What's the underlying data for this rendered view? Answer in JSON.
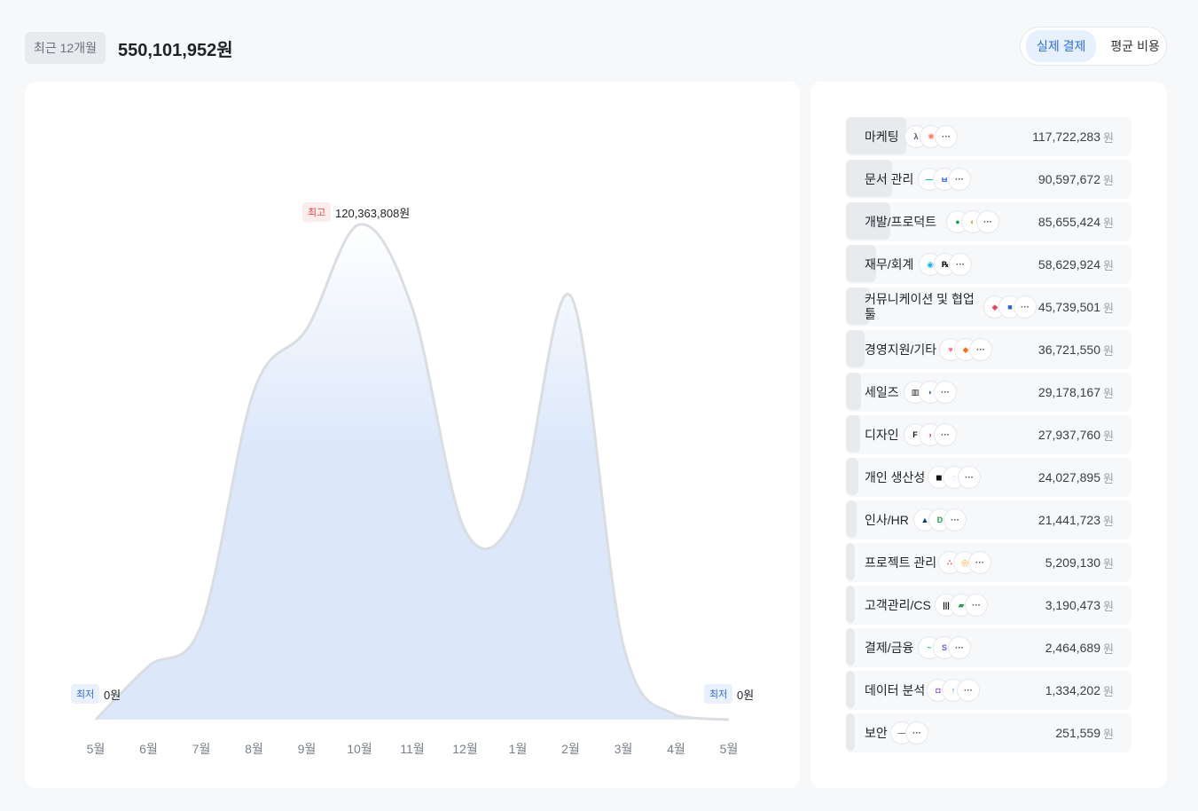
{
  "header": {
    "period": "최근 12개월",
    "total": "550,101,952원"
  },
  "toggle": {
    "actual": "실제 결제",
    "average": "평균 비용",
    "active": "actual"
  },
  "chart": {
    "max_tag": "최고",
    "max_value": "120,363,808원",
    "min_tag": "최저",
    "min_value_left": "0원",
    "min_value_right": "0원"
  },
  "chart_data": {
    "type": "area",
    "categories": [
      "5월",
      "6월",
      "7월",
      "8월",
      "9월",
      "10월",
      "11월",
      "12월",
      "1월",
      "2월",
      "3월",
      "4월",
      "5월"
    ],
    "values": [
      0,
      13000000,
      23000000,
      80000000,
      95000000,
      120363808,
      100000000,
      46000000,
      51000000,
      103000000,
      18000000,
      1000000,
      0
    ],
    "ylim": [
      0,
      120363808
    ],
    "color": "#dce8fa",
    "stroke": "#dadde2"
  },
  "categories": [
    {
      "name": "마케팅",
      "amount": "117,722,283",
      "unit": "원",
      "share": 1.0,
      "icons": [
        {
          "g": "λ",
          "c": "#4b5563"
        },
        {
          "g": "✺",
          "c": "#ff7a59"
        },
        {
          "g": "···",
          "c": "#555"
        }
      ]
    },
    {
      "name": "문서 관리",
      "amount": "90,597,672",
      "unit": "원",
      "share": 0.77,
      "icons": [
        {
          "g": "—",
          "c": "#14b8a6"
        },
        {
          "g": "ㅂ",
          "c": "#2563eb"
        },
        {
          "g": "···",
          "c": "#555"
        }
      ]
    },
    {
      "name": "개발/프로덕트",
      "amount": "85,655,424",
      "unit": "원",
      "share": 0.73,
      "icons": [
        {
          "g": "●",
          "c": "#16a34a"
        },
        {
          "g": "◐",
          "c": "#f59e0b"
        },
        {
          "g": "···",
          "c": "#555"
        }
      ]
    },
    {
      "name": "재무/회계",
      "amount": "58,629,924",
      "unit": "원",
      "share": 0.5,
      "icons": [
        {
          "g": "◉",
          "c": "#13b5ea"
        },
        {
          "g": "℞",
          "c": "#111"
        },
        {
          "g": "···",
          "c": "#555"
        }
      ]
    },
    {
      "name": "커뮤니케이션 및 협업툴",
      "amount": "45,739,501",
      "unit": "원",
      "share": 0.39,
      "icons": [
        {
          "g": "◆",
          "c": "#f43f5e"
        },
        {
          "g": "■",
          "c": "#2563eb"
        },
        {
          "g": "···",
          "c": "#555"
        }
      ]
    },
    {
      "name": "경영지원/기타",
      "amount": "36,721,550",
      "unit": "원",
      "share": 0.31,
      "icons": [
        {
          "g": "♥",
          "c": "#fb7185"
        },
        {
          "g": "◆",
          "c": "#f97316"
        },
        {
          "g": "···",
          "c": "#555"
        }
      ]
    },
    {
      "name": "세일즈",
      "amount": "29,178,167",
      "unit": "원",
      "share": 0.25,
      "icons": [
        {
          "g": "▥",
          "c": "#111"
        },
        {
          "g": "◗",
          "c": "#2563eb"
        },
        {
          "g": "···",
          "c": "#555"
        }
      ]
    },
    {
      "name": "디자인",
      "amount": "27,937,760",
      "unit": "원",
      "share": 0.24,
      "icons": [
        {
          "g": "F",
          "c": "#111"
        },
        {
          "g": "›",
          "c": "#e11d48"
        },
        {
          "g": "···",
          "c": "#555"
        }
      ]
    },
    {
      "name": "개인 생산성",
      "amount": "24,027,895",
      "unit": "원",
      "share": 0.2,
      "icons": [
        {
          "g": "◼",
          "c": "#111"
        },
        {
          "g": "◌",
          "c": "#c084fc"
        },
        {
          "g": "···",
          "c": "#555"
        }
      ]
    },
    {
      "name": "인사/HR",
      "amount": "21,441,723",
      "unit": "원",
      "share": 0.18,
      "icons": [
        {
          "g": "▲",
          "c": "#0f3c8a"
        },
        {
          "g": "D",
          "c": "#16a34a"
        },
        {
          "g": "···",
          "c": "#555"
        }
      ]
    },
    {
      "name": "프로젝트 관리",
      "amount": "5,209,130",
      "unit": "원",
      "share": 0.044,
      "icons": [
        {
          "g": "∴",
          "c": "#f06a6a"
        },
        {
          "g": "◎",
          "c": "#f59e0b"
        },
        {
          "g": "···",
          "c": "#555"
        }
      ]
    },
    {
      "name": "고객관리/CS",
      "amount": "3,190,473",
      "unit": "원",
      "share": 0.027,
      "icons": [
        {
          "g": "|||",
          "c": "#111"
        },
        {
          "g": "▰",
          "c": "#16a34a"
        },
        {
          "g": "···",
          "c": "#555"
        }
      ]
    },
    {
      "name": "결제/금융",
      "amount": "2,464,689",
      "unit": "원",
      "share": 0.021,
      "icons": [
        {
          "g": "~",
          "c": "#14b8a6"
        },
        {
          "g": "S",
          "c": "#635bff"
        },
        {
          "g": "···",
          "c": "#555"
        }
      ]
    },
    {
      "name": "데이터 분석",
      "amount": "1,334,202",
      "unit": "원",
      "share": 0.011,
      "icons": [
        {
          "g": "◘",
          "c": "#7c3aed"
        },
        {
          "g": "↑",
          "c": "#3b82f6"
        },
        {
          "g": "···",
          "c": "#555"
        }
      ]
    },
    {
      "name": "보안",
      "amount": "251,559",
      "unit": "원",
      "share": 0.002,
      "icons": [
        {
          "g": "—",
          "c": "#6b7280"
        },
        {
          "g": "···",
          "c": "#555"
        }
      ]
    }
  ]
}
